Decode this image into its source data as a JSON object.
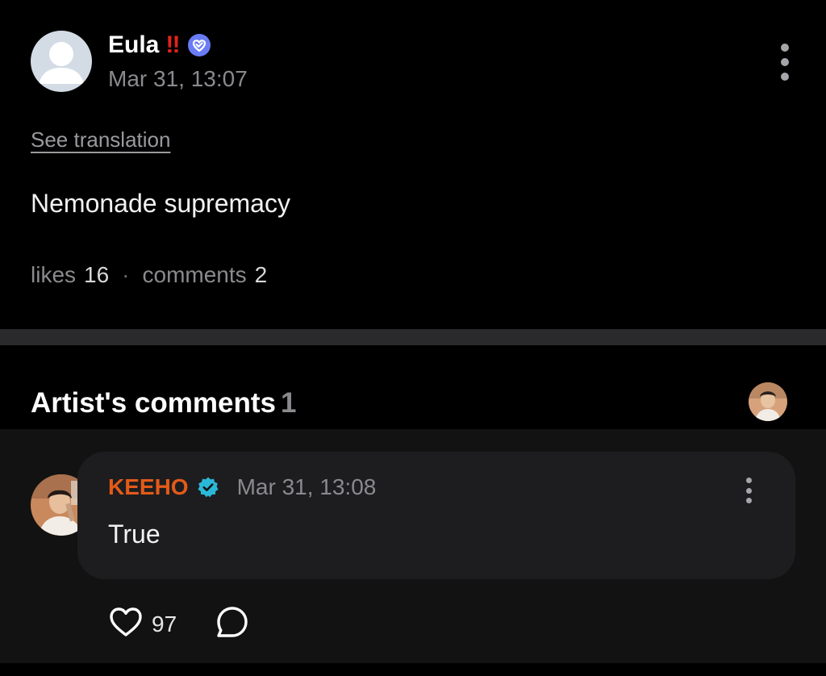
{
  "post": {
    "author": "Eula",
    "author_emphasis": "‼",
    "time": "Mar 31, 13:07",
    "see_translation": "See translation",
    "body": "Nemonade supremacy",
    "likes_label": "likes",
    "likes_count": "16",
    "separator": "·",
    "comments_label": "comments",
    "comments_count": "2",
    "colors": {
      "background": "#000000",
      "verified_badge": "#6a7cf5",
      "emphasis": "#e3231b"
    }
  },
  "artist_comments": {
    "title": "Artist's comments",
    "count": "1"
  },
  "comment": {
    "author": "KEEHO",
    "time": "Mar 31, 13:08",
    "text": "True",
    "like_count": "97",
    "colors": {
      "author": "#e35a19",
      "verified_badge": "#2bb8d8",
      "bubble": "#1d1d1f",
      "section": "#121212"
    }
  },
  "icons": {
    "post_avatar": "default-user-icon",
    "post_verified": "verified-heart-badge-icon",
    "post_more": "more-vertical-icon",
    "comment_verified": "verified-check-badge-icon",
    "comment_more": "more-vertical-icon",
    "like": "heart-outline-icon",
    "reply": "chat-bubble-icon"
  }
}
